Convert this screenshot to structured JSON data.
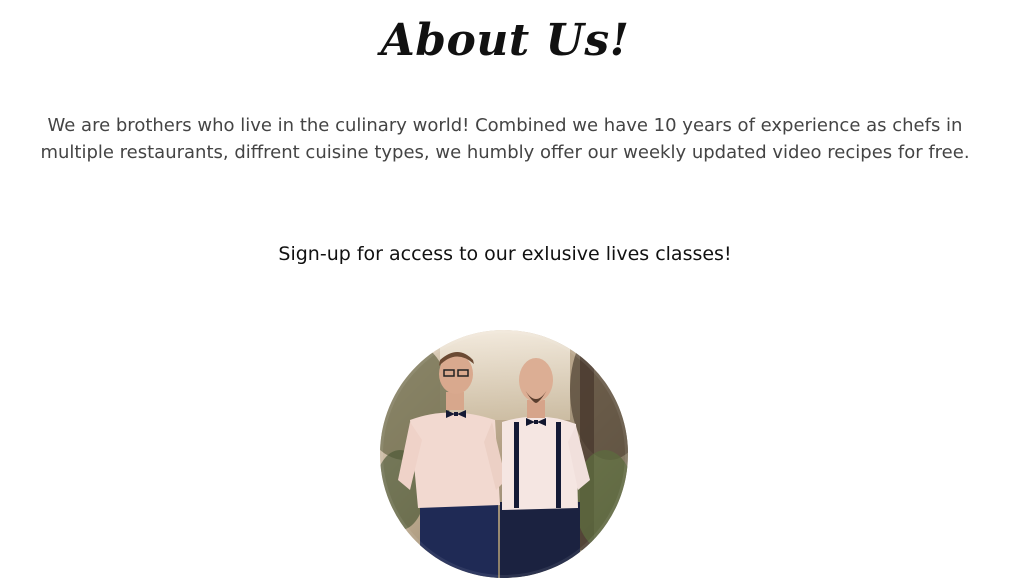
{
  "about": {
    "title": "About Us!",
    "intro": "We are brothers who live in the culinary world! Combined we have 10 years of experience as chefs in multiple restaurants, diffrent cuisine types, we humbly offer our weekly updated video recipes for free.",
    "cta": "Sign-up for access to our exlusive lives classes!"
  },
  "colors": {
    "background": "#ffffff",
    "title": "#111111",
    "body_text": "#444444"
  }
}
